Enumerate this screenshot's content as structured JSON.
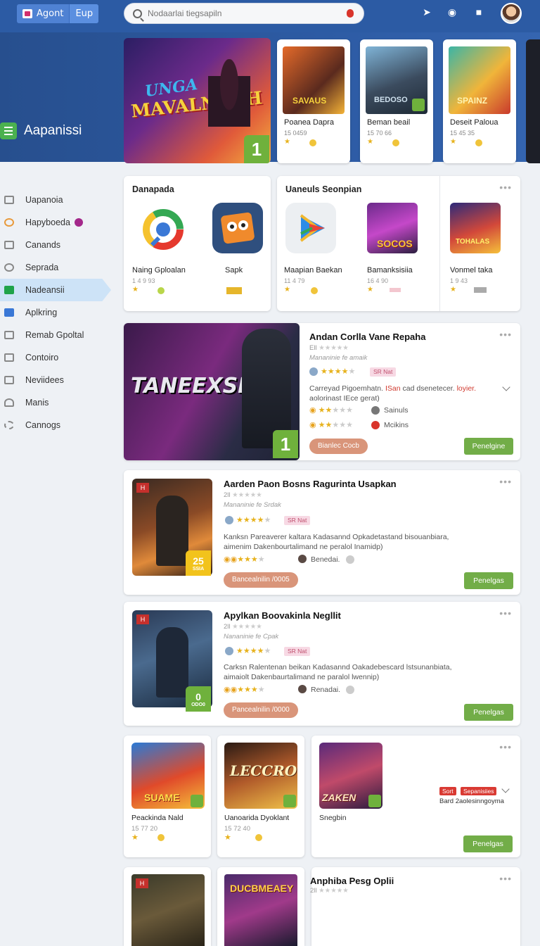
{
  "header": {
    "logo_left": "Agont",
    "logo_right": "Eup",
    "search_placeholder": "Nodaarlai tiegsapiln",
    "icons": [
      "share-icon",
      "notification-icon",
      "wallet-icon"
    ]
  },
  "hero": {
    "title": "Aapanissi",
    "banner": {
      "line1": "UNGA",
      "line2": "MAVALNADH",
      "badge": "1"
    },
    "cards": [
      {
        "name": "Poanea Dapra",
        "size": "15 0459",
        "art_text": "SAVAUS"
      },
      {
        "name": "Beman beail",
        "size": "15 70 66",
        "art_text": "BEDOSO"
      },
      {
        "name": "Deseit Paloua",
        "size": "15 45 35",
        "art_text": "SPAINZ"
      }
    ]
  },
  "sidebar": {
    "items": [
      {
        "label": "Uapanoia"
      },
      {
        "label": "Hapyboeda"
      },
      {
        "label": "Canands"
      },
      {
        "label": "Seprada"
      },
      {
        "label": "Nadeansii"
      },
      {
        "label": "Aplkring"
      },
      {
        "label": "Remab Gpoltal"
      },
      {
        "label": "Contoiro"
      },
      {
        "label": "Neviidees"
      },
      {
        "label": "Manis"
      },
      {
        "label": "Cannogs"
      }
    ]
  },
  "section1": {
    "title": "Danapada",
    "apps": [
      {
        "name": "Naing Gploalan",
        "size": "1 4 9 93"
      },
      {
        "name": "Sapk",
        "size": ""
      }
    ]
  },
  "section2": {
    "title": "Uaneuls Seonpian",
    "apps": [
      {
        "name": "Maapian Baekan",
        "size": "11 4 79"
      },
      {
        "name": "Bamanksisiia",
        "size": "16 4 90",
        "art_text": "SOCOS"
      },
      {
        "name": "Vonmel taka",
        "size": "1 9 43",
        "art_text": "TOHALAS"
      }
    ]
  },
  "list": [
    {
      "title": "Andan Corlla Vane Repaha",
      "meta1": "Ell",
      "meta2": "Mananinie fe amaik",
      "pink": "SR Nat",
      "desc": "Carreyad Pigoemhatn. ",
      "desc_red": "ISan",
      "desc2": " cad dsenetecer. ",
      "desc_red2": "loyier.",
      "desc3": "aolorinast IEce gerat)",
      "row1": "Sainuls",
      "row2": "Mcikins",
      "chip": "Bianlec Cocb",
      "btn": "Penelgine",
      "art_text": "TANEEXSIA",
      "badge": "1"
    },
    {
      "title": "Aarden Paon Bosns Ragurinta Usapkan",
      "meta1": "2ll",
      "meta2": "Mananinie fe Srdak",
      "pink": "SR Nat",
      "desc": "Kanksn Pareaverer kaltara Kadasannd Opkadetastand bisouanbiara, aimenim Dakenbourtalimand ne peralol Inamidp)",
      "row1": "Benedai.",
      "chip": "Bancealnilin /0005",
      "btn": "Penelgas",
      "badge_top": "25",
      "badge_bottom": "SSIA"
    },
    {
      "title": "Apylkan Boovakinla Negllit",
      "meta1": "2ll",
      "meta2": "Nananinie fe Cpak",
      "pink": "SR Nat",
      "desc": "Carksn Ralentenan beikan Kadasannd Oakadebescard lstsunanbiata, aimaiolt Dakenbaurtalimand ne paralol lwennip)",
      "row1": "Renadai.",
      "chip": "Pancealnilin /0000",
      "btn": "Penelgas",
      "badge_top": "0",
      "badge_bottom": "ODO0"
    }
  ],
  "row4": {
    "apps": [
      {
        "name": "Peackinda Nald",
        "size": "15 77 20",
        "art_text": "SUAME"
      },
      {
        "name": "Uanoarida Dyoklant",
        "size": "15 72 40",
        "art_text": "LECCRO"
      }
    ],
    "wide": {
      "art_text": "ZAKEN",
      "name": "Snegbin",
      "tag1": "Sort",
      "tag2": "Sepanisiies",
      "sub": "Bard 2aolesinngoyma",
      "btn": "Penelgas"
    }
  },
  "row5": {
    "art1": "",
    "art2": "DUCBMEAEY",
    "title": "Anphiba Pesg Oplii",
    "meta": "2ll"
  }
}
